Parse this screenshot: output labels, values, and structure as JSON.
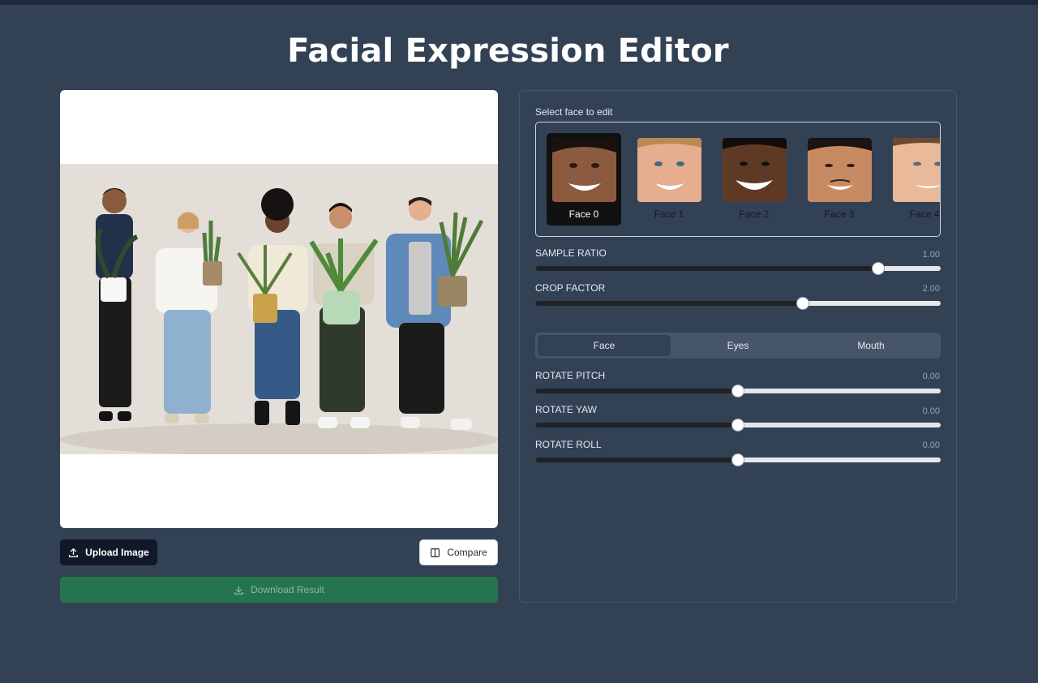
{
  "app": {
    "title": "Facial Expression Editor"
  },
  "buttons": {
    "upload_label": "Upload Image",
    "compare_label": "Compare",
    "download_label": "Download Result"
  },
  "face_selector": {
    "label": "Select face to edit",
    "selected_index": 0,
    "faces": [
      {
        "name": "Face 0"
      },
      {
        "name": "Face 1"
      },
      {
        "name": "Face 2"
      },
      {
        "name": "Face 3"
      },
      {
        "name": "Face 4"
      }
    ]
  },
  "global_sliders": [
    {
      "label": "SAMPLE RATIO",
      "value": "1.00",
      "fraction": 0.845
    },
    {
      "label": "CROP FACTOR",
      "value": "2.00",
      "fraction": 0.66
    }
  ],
  "tabs": [
    {
      "label": "Face",
      "active": true
    },
    {
      "label": "Eyes",
      "active": false
    },
    {
      "label": "Mouth",
      "active": false
    }
  ],
  "face_sliders": [
    {
      "label": "ROTATE PITCH",
      "value": "0.00",
      "fraction": 0.5
    },
    {
      "label": "ROTATE YAW",
      "value": "0.00",
      "fraction": 0.5
    },
    {
      "label": "ROTATE ROLL",
      "value": "0.00",
      "fraction": 0.5
    }
  ],
  "colors": {
    "background": "#334155",
    "primary_button": "#111827",
    "download_button": "#25744f",
    "slider_fill": "#1f2226"
  }
}
